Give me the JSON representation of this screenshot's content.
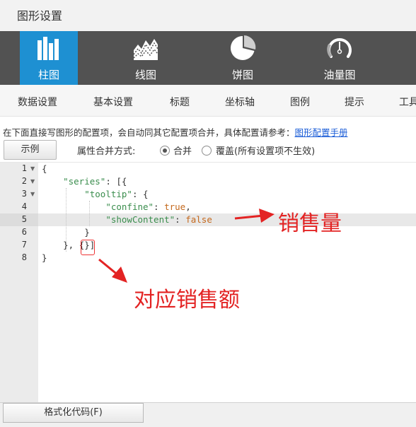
{
  "window": {
    "title": "图形设置"
  },
  "chart_tabs": [
    {
      "label": "柱图",
      "icon": "bar-chart-icon",
      "active": true
    },
    {
      "label": "线图",
      "icon": "line-chart-icon",
      "active": false
    },
    {
      "label": "饼图",
      "icon": "pie-chart-icon",
      "active": false
    },
    {
      "label": "油量图",
      "icon": "gauge-icon",
      "active": false
    }
  ],
  "setting_tabs": [
    "数据设置",
    "基本设置",
    "标题",
    "坐标轴",
    "图例",
    "提示",
    "工具"
  ],
  "hint": {
    "text": "在下面直接写图形的配置项，会自动同其它配置项合并，具体配置请参考：",
    "link": "图形配置手册"
  },
  "example_button": "示例",
  "merge": {
    "label": "属性合并方式:",
    "options": [
      {
        "label": "合并",
        "checked": true
      },
      {
        "label": "覆盖(所有设置项不生效)",
        "checked": false
      }
    ]
  },
  "editor": {
    "line_numbers": [
      "1",
      "2",
      "3",
      "4",
      "5",
      "6",
      "7",
      "8"
    ],
    "active_line": 5,
    "code": {
      "l1": "{",
      "l2_key": "\"series\"",
      "l2_rest": ": [{",
      "l3_key": "\"tooltip\"",
      "l3_rest": ": {",
      "l4_key": "\"confine\"",
      "l4_colon": ": ",
      "l4_val": "true",
      "l4_end": ",",
      "l5_key": "\"showContent\"",
      "l5_colon": ": ",
      "l5_val": "false",
      "l6": "}",
      "l7_a": "}, ",
      "l7_b": "{}",
      "l7_c": "]",
      "l8": "}"
    }
  },
  "format_button": "格式化代码(F)",
  "annotations": {
    "sales": "销售量",
    "corresponding_sales": "对应销售额"
  },
  "colors": {
    "active_tab": "#1e90d2",
    "tab_bar": "#525252",
    "annotation": "#e32323",
    "json_key": "#3a8d4d",
    "json_bool": "#c4681c"
  }
}
